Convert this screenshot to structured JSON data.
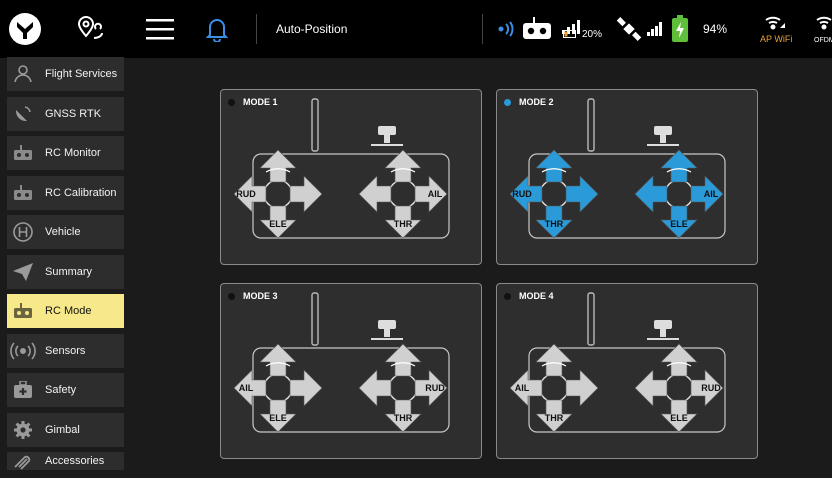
{
  "topbar": {
    "title": "Auto-Position",
    "rc_battery": "20%",
    "battery_percent": "94%",
    "ap_wifi": "AP WiFi",
    "ofdm": "OFDM"
  },
  "sidebar": {
    "items": [
      {
        "label": "Flight Services",
        "icon": "person-pin-icon",
        "active": false
      },
      {
        "label": "GNSS RTK",
        "icon": "satellite-dish-icon",
        "active": false
      },
      {
        "label": "RC Monitor",
        "icon": "remote-controller-icon",
        "active": false
      },
      {
        "label": "RC Calibration",
        "icon": "remote-controller-icon",
        "active": false
      },
      {
        "label": "Vehicle",
        "icon": "h-circle-icon",
        "active": false
      },
      {
        "label": "Summary",
        "icon": "paper-plane-icon",
        "active": false
      },
      {
        "label": "RC Mode",
        "icon": "remote-controller-icon",
        "active": true
      },
      {
        "label": "Sensors",
        "icon": "sensor-waves-icon",
        "active": false
      },
      {
        "label": "Safety",
        "icon": "first-aid-kit-icon",
        "active": false
      },
      {
        "label": "Gimbal",
        "icon": "gear-icon",
        "active": false
      },
      {
        "label": "Accessories",
        "icon": "paperclip-icon",
        "active": false
      }
    ]
  },
  "modes": [
    {
      "title": "MODE 1",
      "active": false,
      "left": {
        "left": "RUD",
        "bottom": "ELE"
      },
      "right": {
        "right": "AIL",
        "bottom": "THR"
      }
    },
    {
      "title": "MODE 2",
      "active": true,
      "left": {
        "left": "RUD",
        "bottom": "THR"
      },
      "right": {
        "right": "AIL",
        "bottom": "ELE"
      }
    },
    {
      "title": "MODE 3",
      "active": false,
      "left": {
        "left": "AIL",
        "bottom": "ELE"
      },
      "right": {
        "right": "RUD",
        "bottom": "THR"
      }
    },
    {
      "title": "MODE 4",
      "active": false,
      "left": {
        "left": "AIL",
        "bottom": "THR"
      },
      "right": {
        "right": "RUD",
        "bottom": "ELE"
      }
    }
  ],
  "colors": {
    "active_arrow": "#2a9bd8",
    "inactive_arrow": "#d0d0d0",
    "highlight": "#f7e98a"
  }
}
